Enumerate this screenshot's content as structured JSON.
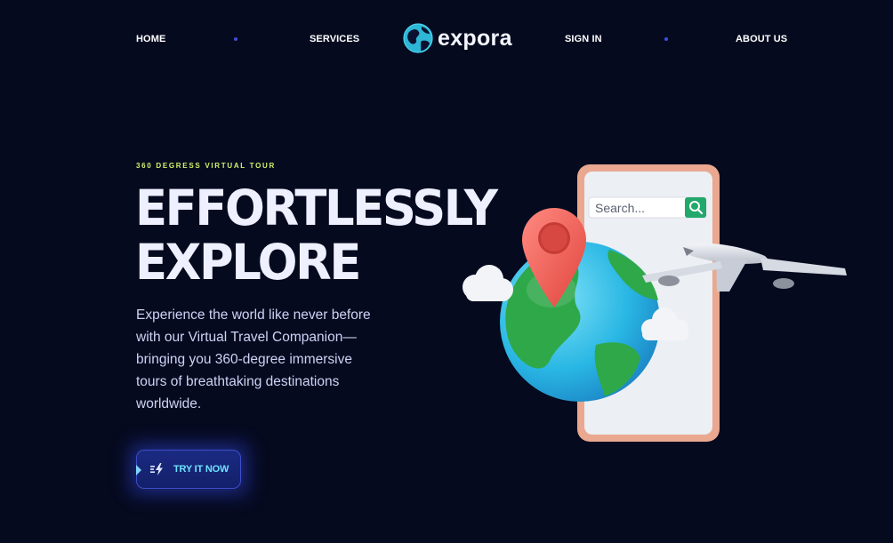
{
  "nav": {
    "home": "HOME",
    "services": "SERVICES",
    "sign_in": "SIGN IN",
    "about": "ABOUT US"
  },
  "brand": {
    "name": "expora",
    "logo_icon": "globe-icon"
  },
  "hero": {
    "eyebrow": "360 DEGRESS VIRTUAL TOUR",
    "headline_line1": "EFFORTLESSLY",
    "headline_line2": "EXPLORE",
    "description": "Experience the world like never before with our Virtual Travel Companion—bringing you 360-degree immersive tours of breathtaking destinations worldwide.",
    "cta_label": "TRY IT NOW",
    "cta_icon": "lightning-icon"
  },
  "illustration": {
    "search_placeholder": "Search...",
    "search_icon": "search-icon"
  },
  "colors": {
    "background": "#060a1f",
    "accent_lime": "#d4f267",
    "accent_cyan": "#6fe1ff",
    "button_bg": "#1b2a82",
    "nav_dot": "#3b4fd8"
  }
}
